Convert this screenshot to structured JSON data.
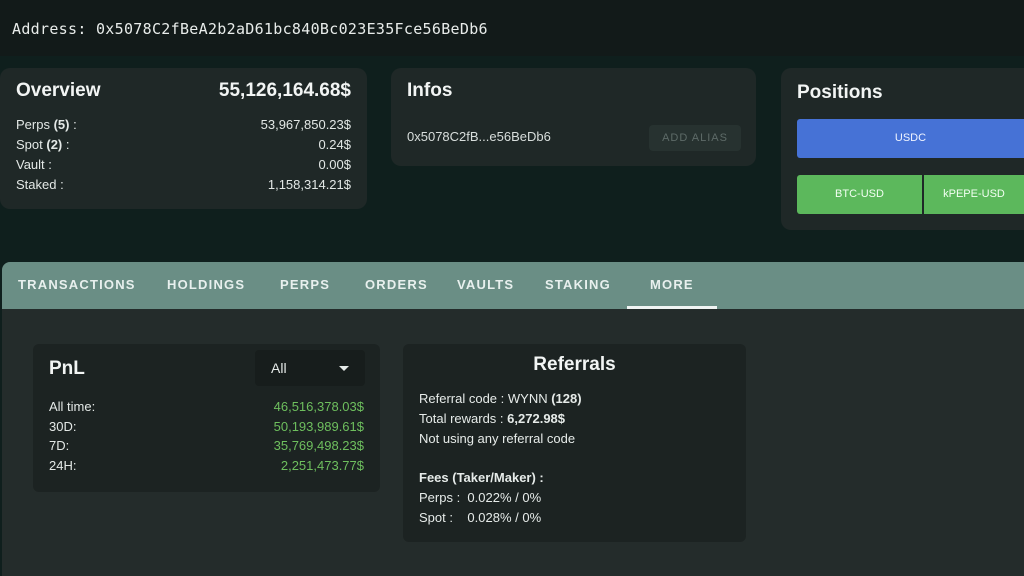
{
  "address": "Address: 0x5078C2fBeA2b2aD61bc840Bc023E35Fce56BeDb6",
  "overview": {
    "title": "Overview",
    "total": "55,126,164.68$",
    "rows": [
      {
        "label": "Perps",
        "count": "(5)",
        "suffix": " :",
        "value": "53,967,850.23$"
      },
      {
        "label": "Spot",
        "count": "(2)",
        "suffix": " :",
        "value": "0.24$"
      },
      {
        "label": "Vault :",
        "count": "",
        "suffix": "",
        "value": "0.00$"
      },
      {
        "label": "Staked :",
        "count": "",
        "suffix": "",
        "value": "1,158,314.21$"
      }
    ]
  },
  "infos": {
    "title": "Infos",
    "short_address": "0x5078C2fB...e56BeDb6",
    "alias_button": "ADD ALIAS"
  },
  "positions": {
    "title": "Positions",
    "usdc": "USDC",
    "btc": "BTC-USD",
    "kpepe": "kPEPE-USD",
    "colors": {
      "usdc": "#4672d6",
      "perps": "#5cb85c"
    }
  },
  "tabs": [
    "TRANSACTIONS",
    "HOLDINGS",
    "PERPS",
    "ORDERS",
    "VAULTS",
    "STAKING",
    "MORE"
  ],
  "active_tab": "MORE",
  "pnl": {
    "title": "PnL",
    "filter": "All",
    "rows": [
      {
        "label": "All time:",
        "value": "46,516,378.03$"
      },
      {
        "label": "30D:",
        "value": "50,193,989.61$"
      },
      {
        "label": "7D:",
        "value": "35,769,498.23$"
      },
      {
        "label": "24H:",
        "value": "2,251,473.77$"
      }
    ],
    "positive_color": "#6ebf5e"
  },
  "referrals": {
    "title": "Referrals",
    "code_label": "Referral code : WYNN",
    "code_count": "(128)",
    "rewards_label": "Total rewards :",
    "rewards_value": "6,272.98$",
    "not_using": "Not using any referral code",
    "fees_title": "Fees (Taker/Maker) :",
    "perps_fee": "Perps :  0.022% / 0%",
    "spot_fee": "Spot :    0.028% / 0%"
  }
}
